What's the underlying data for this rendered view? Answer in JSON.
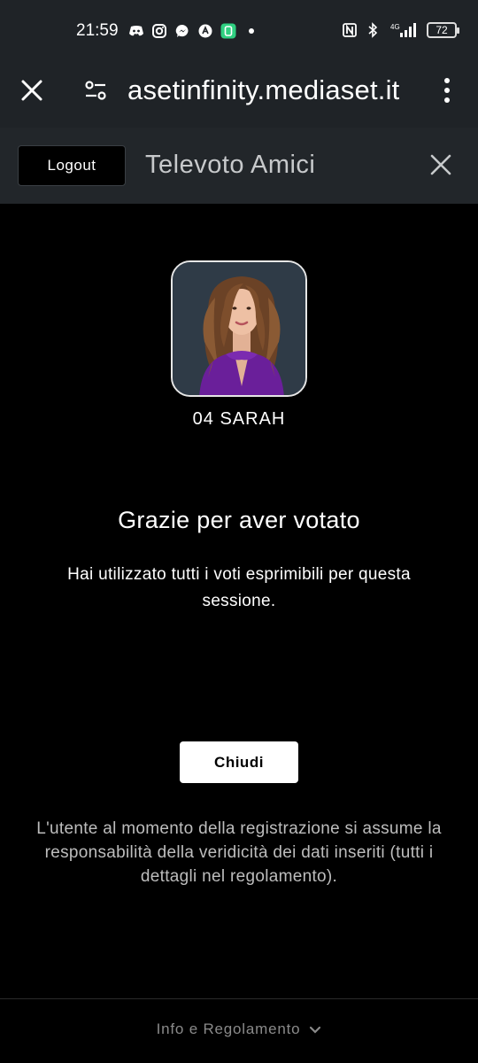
{
  "status_bar": {
    "time": "21:59",
    "left_icons": [
      "discord-icon",
      "instagram-icon",
      "messenger-icon",
      "app-icon",
      "green-app-icon",
      "dot-icon"
    ],
    "right_icons": [
      "nfc-icon",
      "bluetooth-icon",
      "signal-4g-icon"
    ],
    "network": "4G",
    "battery": "72"
  },
  "browser": {
    "url": "asetinfinity.mediaset.it",
    "close_icon": "close-icon",
    "settings_icon": "site-settings-icon",
    "menu_icon": "more-vert-icon"
  },
  "header": {
    "logout_label": "Logout",
    "title": "Televoto Amici",
    "close_icon": "close-icon"
  },
  "contestant": {
    "name": "04 SARAH"
  },
  "confirmation": {
    "title": "Grazie per aver votato",
    "message": "Hai utilizzato tutti i voti esprimibili per questa sessione.",
    "close_label": "Chiudi"
  },
  "disclaimer": "L'utente al momento della registrazione si assume la responsabilità della veridicità dei dati inseriti (tutti i dettagli nel regolamento).",
  "footer": {
    "info_label": "Info e Regolamento"
  },
  "colors": {
    "bar_bg": "#1f2327",
    "header_bg": "#22262a",
    "page_bg": "#000000",
    "button_bg": "#ffffff",
    "dress_purple": "#6a1f9a"
  }
}
